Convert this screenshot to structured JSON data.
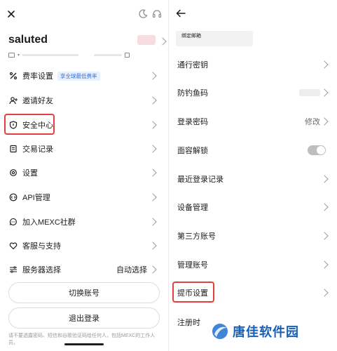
{
  "left": {
    "username": "saluted",
    "menu": [
      {
        "label": "费率设置",
        "badge": "享全球最低费率",
        "icon": "percent-icon"
      },
      {
        "label": "邀请好友",
        "icon": "add-user-icon"
      },
      {
        "label": "安全中心",
        "icon": "shield-icon"
      },
      {
        "label": "交易记录",
        "icon": "document-icon"
      },
      {
        "label": "设置",
        "icon": "gear-icon"
      },
      {
        "label": "API管理",
        "icon": "api-icon"
      },
      {
        "label": "加入MEXC社群",
        "icon": "chat-icon"
      },
      {
        "label": "客服与支持",
        "icon": "heart-icon"
      },
      {
        "label": "服务器选择",
        "value": "自动选择",
        "icon": "sliders-icon"
      }
    ],
    "buttons": {
      "switch_account": "切换账号",
      "logout": "退出登录"
    },
    "footnote": "请不要透露密码、短信和谷歌验证码给任何人，包括MEXC的工作人员。"
  },
  "right": {
    "top_label": "绑定邮箱",
    "items": [
      {
        "label": "通行密钥"
      },
      {
        "label": "防钓鱼码"
      },
      {
        "label": "登录密码",
        "value": "修改"
      },
      {
        "label": "面容解锁",
        "toggle": false
      },
      {
        "label": "最近登录记录"
      },
      {
        "label": "设备管理"
      },
      {
        "label": "第三方账号"
      },
      {
        "label": "管理账号"
      },
      {
        "label": "提币设置"
      },
      {
        "label": "注册时"
      }
    ]
  },
  "watermark": "唐佳软件园",
  "colors": {
    "highlight": "#e2403c",
    "badge_text": "#2f6fe0",
    "watermark": "#1a5fb4"
  }
}
